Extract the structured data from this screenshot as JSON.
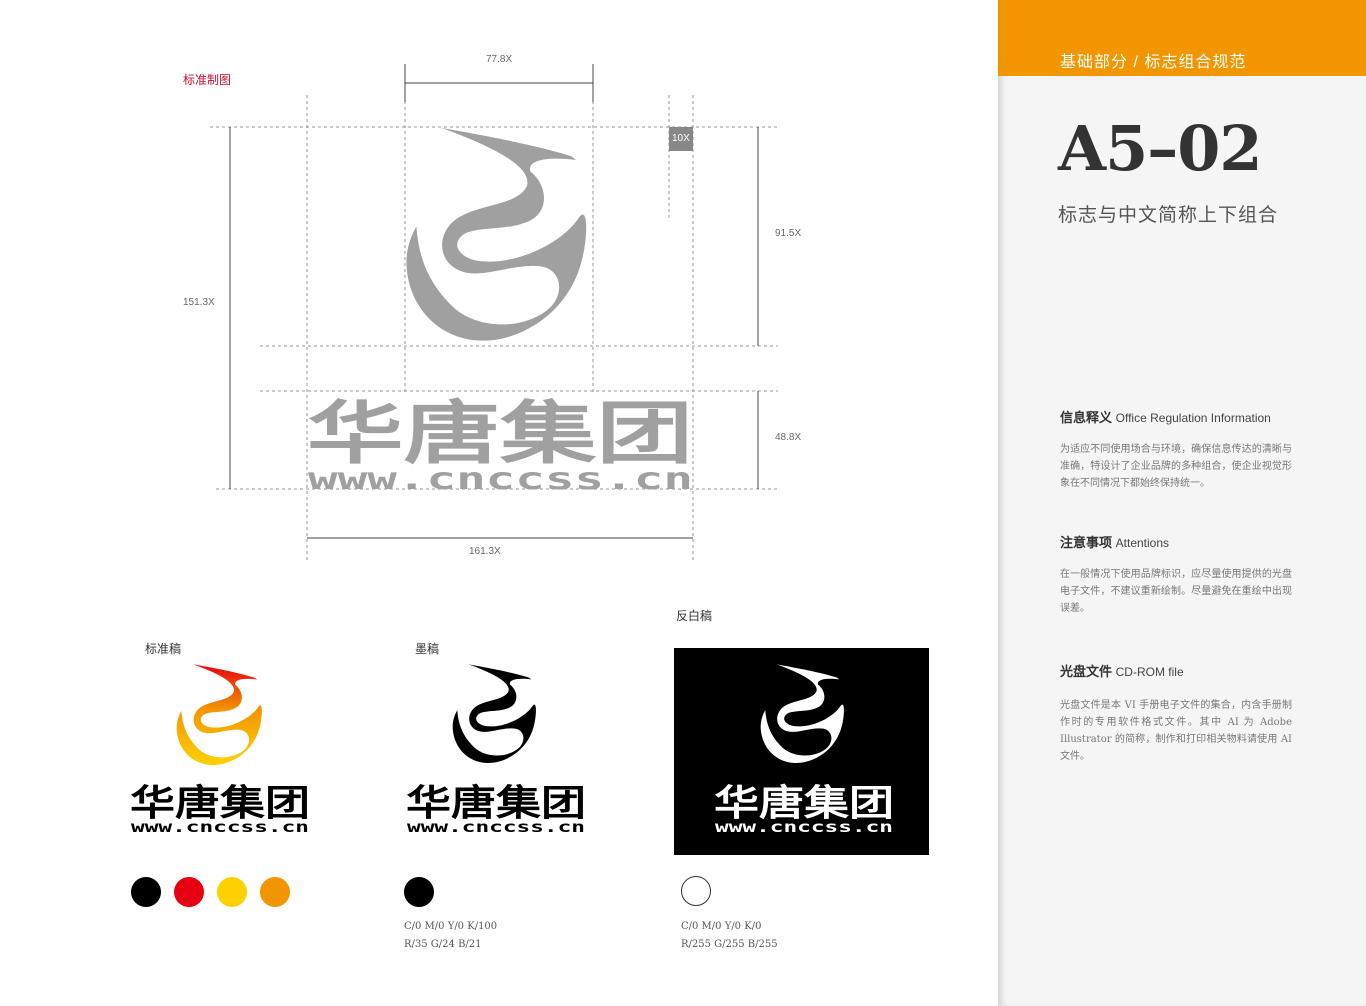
{
  "header": {
    "section": "基础部分 / 标志组合规范"
  },
  "page": {
    "code": "A5–02",
    "subtitle": "标志与中文简称上下组合"
  },
  "info": {
    "title_cn": "信息释义",
    "title_en": "Office Regulation Information",
    "body": "为适应不同使用场合与环境，确保信息传达的清晰与准确，特设计了企业品牌的多种组合，使企业视觉形象在不同情况下都始终保持统一。"
  },
  "attention": {
    "title_cn": "注意事项",
    "title_en": "Attentions",
    "body": "在一般情况下使用品牌标识，应尽量使用提供的光盘电子文件，不建议重新绘制。尽量避免在重绘中出现误差。"
  },
  "cdrom": {
    "title_cn": "光盘文件",
    "title_en": "CD-ROM file",
    "body": "光盘文件是本 VI 手册电子文件的集合，内含手册制作时的专用软件格式文件。其中 AI 为 Adobe Illustrator 的简称，制作和打印相关物料请使用 AI 文件。"
  },
  "drawing": {
    "label": "标准制图",
    "dims": {
      "top": "77.8X",
      "unit": "10X",
      "right_upper": "91.5X",
      "left": "151.3X",
      "right_lower": "48.8X",
      "bottom": "161.3X"
    }
  },
  "logo": {
    "name_cn": "华唐集团",
    "url": "www.cnccss.cn"
  },
  "variants": {
    "standard_label": "标准稿",
    "mono_label": "墨稿",
    "reverse_label": "反白稿"
  },
  "colors": {
    "standard": [
      "#000000",
      "#e60012",
      "#ffd100",
      "#f29600"
    ],
    "mono": "#000000",
    "reverse": "#ffffff",
    "accent": "#f29600",
    "drawing_gray": "#a0a0a0"
  },
  "specs": {
    "mono_line1": "C/0 M/0 Y/0 K/100",
    "mono_line2": "R/35 G/24 B/21",
    "reverse_line1": "C/0 M/0 Y/0 K/0",
    "reverse_line2": "R/255 G/255 B/255"
  }
}
